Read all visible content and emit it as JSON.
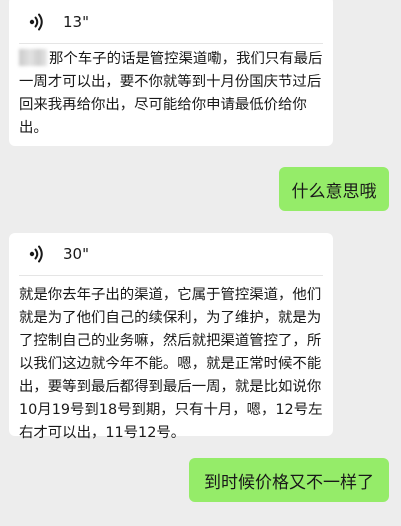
{
  "messages": [
    {
      "side": "left",
      "type": "voice",
      "duration": "13\"",
      "transcript_masked_prefix": true,
      "transcript": "那个车子的话是管控渠道嘞，我们只有最后一周才可以出，要不你就等到十月份国庆节过后回来我再给你出，尽可能给你申请最低价给你出。"
    },
    {
      "side": "right",
      "type": "text",
      "text": "什么意思哦"
    },
    {
      "side": "left",
      "type": "voice",
      "duration": "30\"",
      "transcript": "就是你去年子出的渠道，它属于管控渠道，他们就是为了他们自己的续保利，为了维护，就是为了控制自己的业务嘛，然后就把渠道管控了，所以我们这边就今年不能。嗯，就是正常时候不能出，要等到最后都得到最后一周，就是比如说你10月19号到18号到期，只有十月，嗯，12号左右才可以出，11号12号。"
    },
    {
      "side": "right",
      "type": "text",
      "text": "到时候价格又不一样了"
    }
  ],
  "icons": {
    "voice": "voice-wave-icon"
  },
  "colors": {
    "background": "#ededed",
    "left_bubble": "#ffffff",
    "right_bubble": "#95ec69"
  }
}
